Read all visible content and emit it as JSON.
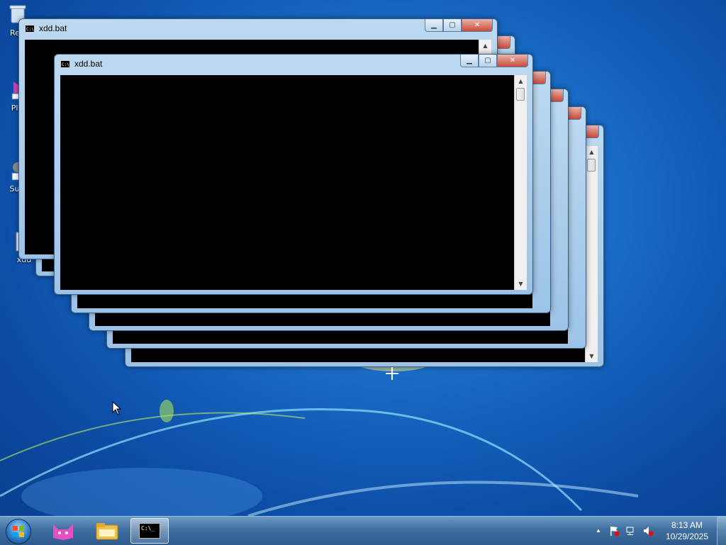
{
  "desktop": {
    "icons": [
      {
        "label": "Rec",
        "icon": "recycle-bin-icon"
      },
      {
        "label": "Pla",
        "icon": "app-shortcut-icon"
      },
      {
        "label": "Sup",
        "icon": "user-shortcut-icon"
      },
      {
        "label": "xdd",
        "icon": "batch-file-icon"
      }
    ]
  },
  "windows": {
    "front": {
      "title": "xdd.bat"
    },
    "back": {
      "title": "xdd.bat"
    },
    "buttons": {
      "minimize": "▁",
      "maximize": "▢",
      "close": "✕"
    },
    "scroll_up": "▲",
    "scroll_down": "▼"
  },
  "taskbar": {
    "apps": [
      {
        "name": "start-button",
        "icon": "windows-orb-icon"
      },
      {
        "name": "taskbar-app-cat",
        "icon": "cat-icon"
      },
      {
        "name": "taskbar-app-explorer",
        "icon": "folder-icon"
      },
      {
        "name": "taskbar-app-cmd",
        "icon": "cmd-icon",
        "label": "C:\\_"
      }
    ],
    "tray": {
      "show_hidden": "▲",
      "clock_time": "8:13 AM",
      "clock_date": "10/29/2025"
    }
  }
}
